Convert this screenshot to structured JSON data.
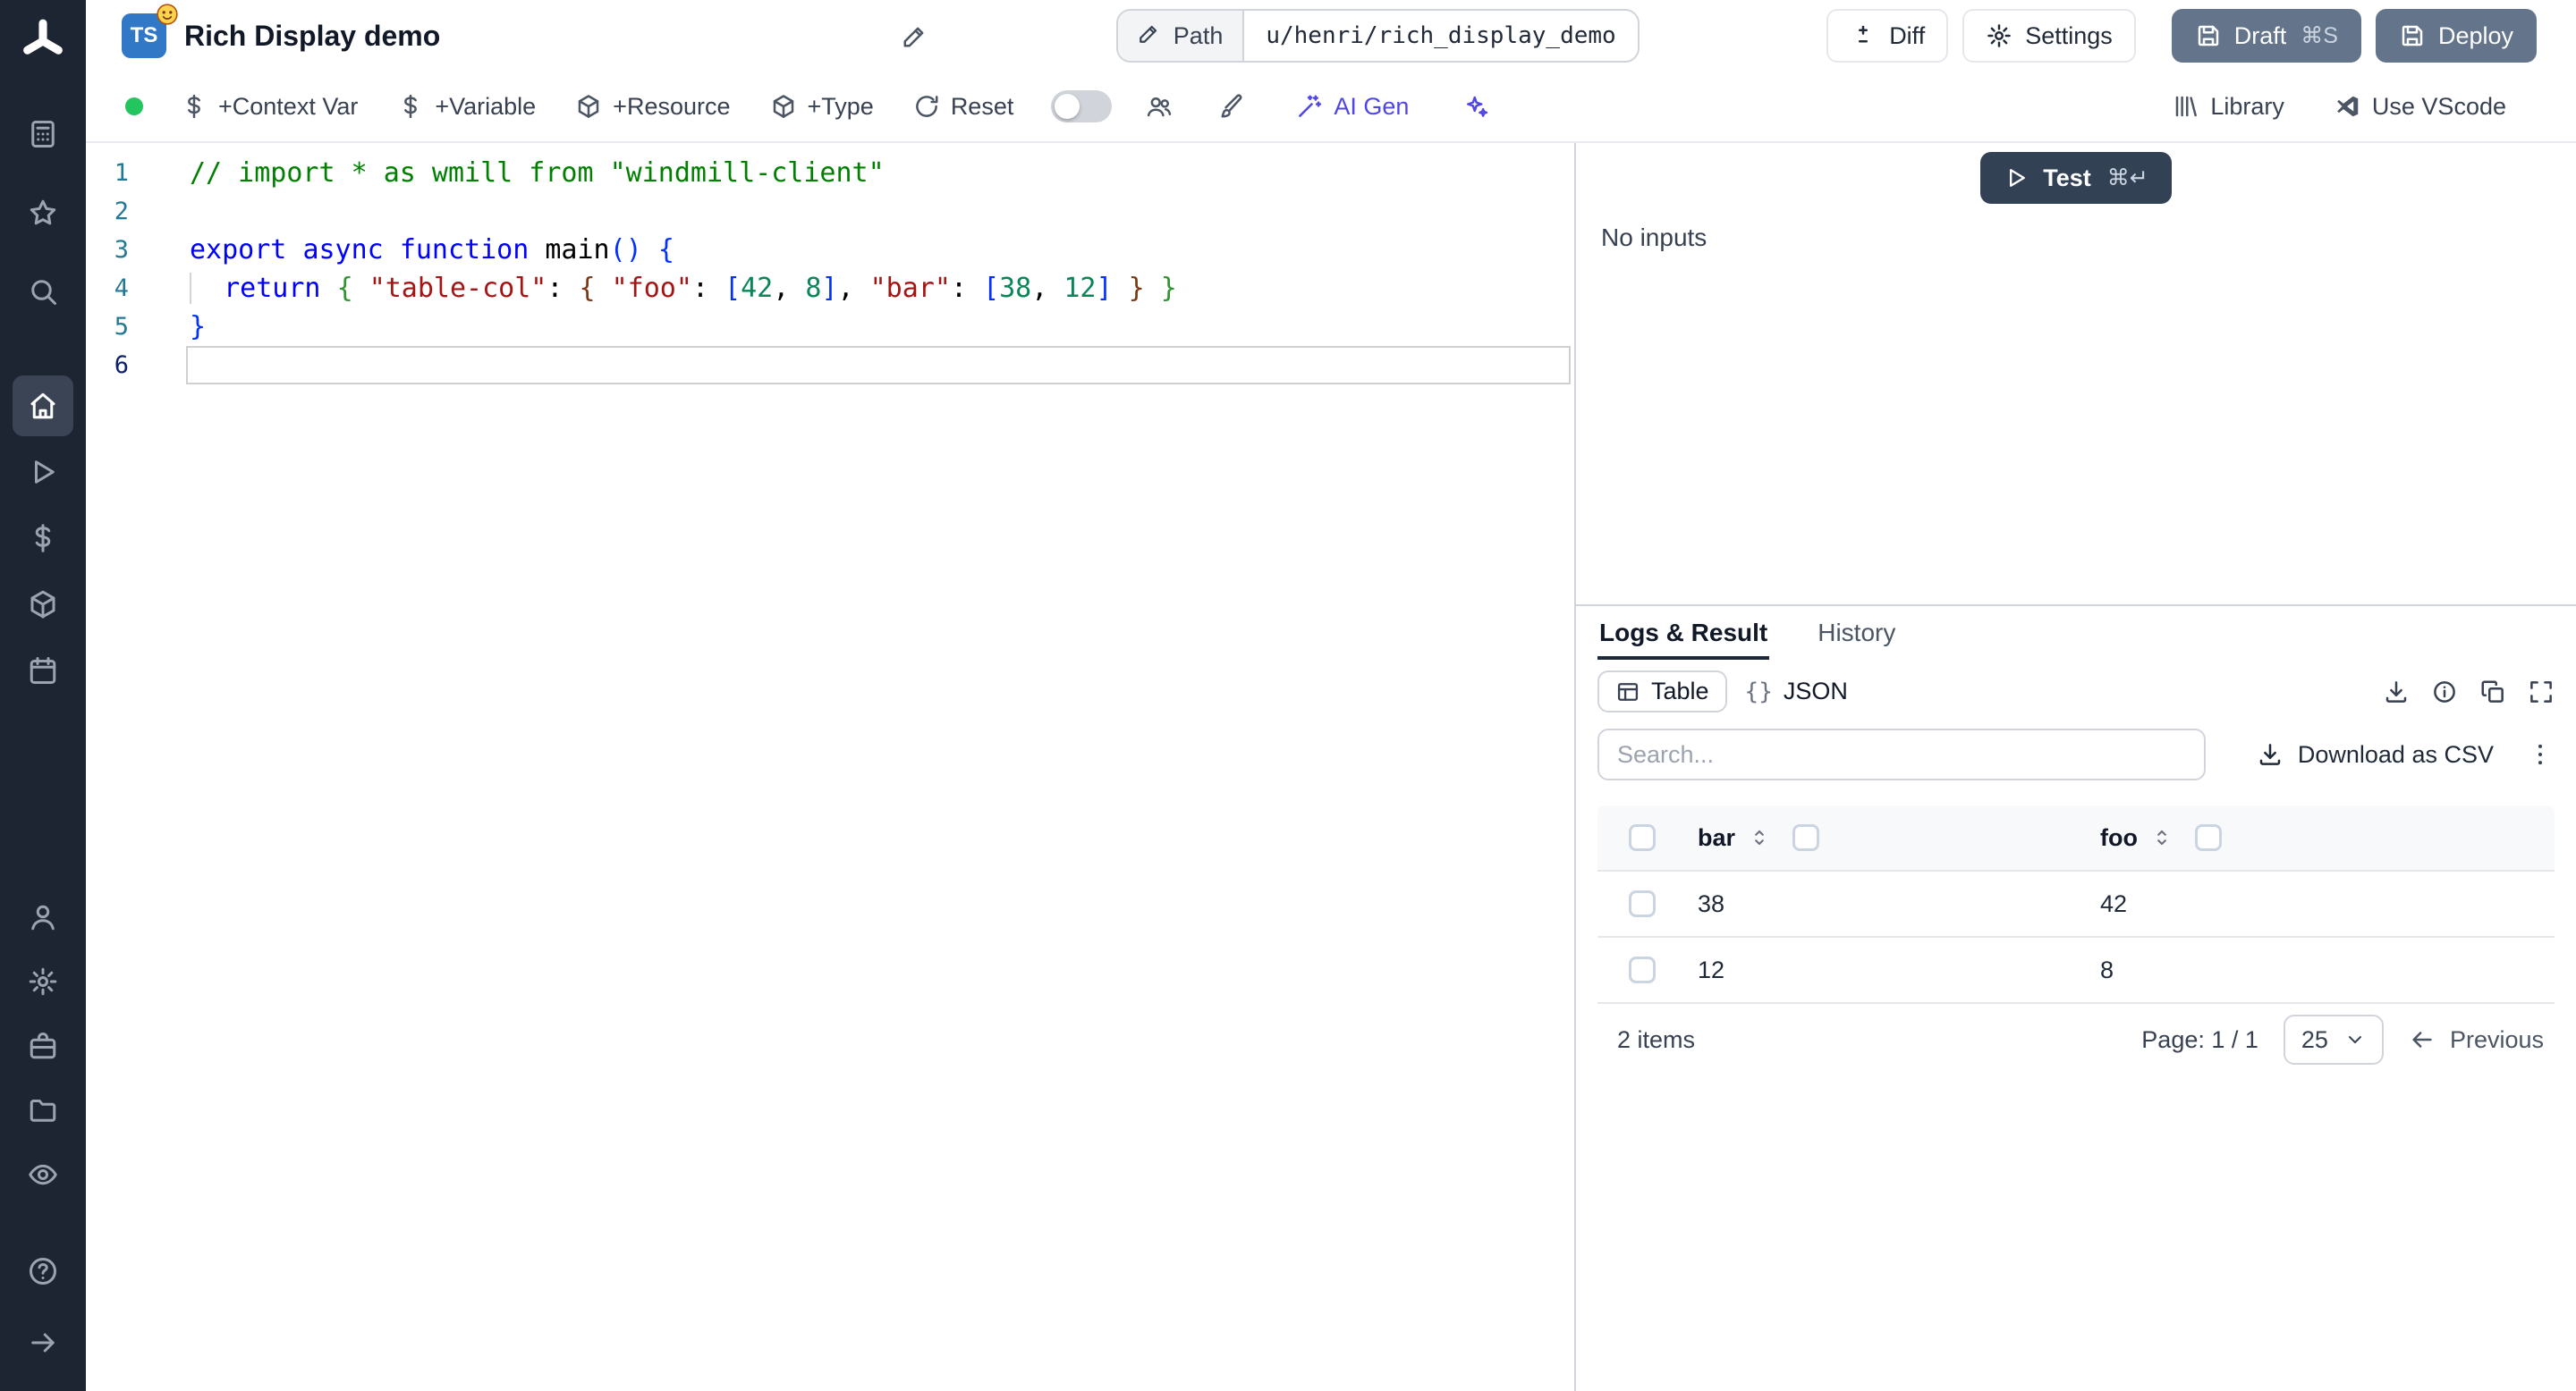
{
  "colors": {
    "ts_badge": "#3178c6",
    "status_dot": "#22c55e",
    "ai_gen": "#4f46e5",
    "slate_button": "#64748b",
    "test_button": "#334155"
  },
  "sidebar": {
    "groups": [
      {
        "items": [
          {
            "icon": "calculator",
            "name": "apps"
          },
          {
            "icon": "star",
            "name": "favorites"
          },
          {
            "icon": "search",
            "name": "search"
          }
        ]
      },
      {
        "items": [
          {
            "icon": "home",
            "name": "home",
            "active": true
          },
          {
            "icon": "play",
            "name": "runs"
          },
          {
            "icon": "dollar",
            "name": "variables"
          },
          {
            "icon": "cube",
            "name": "resources"
          },
          {
            "icon": "calendar",
            "name": "schedules"
          }
        ]
      },
      {
        "items": [
          {
            "icon": "user",
            "name": "users"
          },
          {
            "icon": "gear",
            "name": "settings"
          },
          {
            "icon": "briefcase",
            "name": "workers"
          },
          {
            "icon": "folder",
            "name": "folders"
          },
          {
            "icon": "eye",
            "name": "audit-logs"
          }
        ]
      },
      {
        "items": [
          {
            "icon": "help",
            "name": "help"
          },
          {
            "icon": "arrow-right",
            "name": "expand-sidebar"
          }
        ]
      }
    ]
  },
  "header": {
    "lang_badge": "TS",
    "title": "Rich Display demo",
    "path_label": "Path",
    "path_value": "u/henri/rich_display_demo",
    "diff_label": "Diff",
    "settings_label": "Settings",
    "draft_label": "Draft",
    "draft_shortcut": "⌘S",
    "deploy_label": "Deploy"
  },
  "toolbar": {
    "context_var_label": "+Context Var",
    "variable_label": "+Variable",
    "resource_label": "+Resource",
    "type_label": "+Type",
    "reset_label": "Reset",
    "ai_gen_label": "AI Gen",
    "library_label": "Library",
    "vscode_label": "Use VScode"
  },
  "editor": {
    "lines": [
      {
        "num": "1",
        "tokens": [
          {
            "t": "// import * as wmill from \"windmill-client\"",
            "c": "com"
          }
        ]
      },
      {
        "num": "2",
        "tokens": []
      },
      {
        "num": "3",
        "tokens": [
          {
            "t": "export",
            "c": "kw"
          },
          {
            "t": " ",
            "c": ""
          },
          {
            "t": "async",
            "c": "kw"
          },
          {
            "t": " ",
            "c": ""
          },
          {
            "t": "function",
            "c": "kw"
          },
          {
            "t": " ",
            "c": ""
          },
          {
            "t": "main",
            "c": ""
          },
          {
            "t": "(",
            "c": "b1"
          },
          {
            "t": ")",
            "c": "b1"
          },
          {
            "t": " ",
            "c": ""
          },
          {
            "t": "{",
            "c": "b1"
          }
        ]
      },
      {
        "num": "4",
        "tokens": [
          {
            "t": "  ",
            "c": "guide"
          },
          {
            "t": "return",
            "c": "kw"
          },
          {
            "t": " ",
            "c": ""
          },
          {
            "t": "{",
            "c": "b2"
          },
          {
            "t": " ",
            "c": ""
          },
          {
            "t": "\"table-col\"",
            "c": "str"
          },
          {
            "t": ": ",
            "c": ""
          },
          {
            "t": "{",
            "c": "b3"
          },
          {
            "t": " ",
            "c": ""
          },
          {
            "t": "\"foo\"",
            "c": "str"
          },
          {
            "t": ": ",
            "c": ""
          },
          {
            "t": "[",
            "c": "b1"
          },
          {
            "t": "42",
            "c": "num"
          },
          {
            "t": ", ",
            "c": ""
          },
          {
            "t": "8",
            "c": "num"
          },
          {
            "t": "]",
            "c": "b1"
          },
          {
            "t": ", ",
            "c": ""
          },
          {
            "t": "\"bar\"",
            "c": "str"
          },
          {
            "t": ": ",
            "c": ""
          },
          {
            "t": "[",
            "c": "b1"
          },
          {
            "t": "38",
            "c": "num"
          },
          {
            "t": ", ",
            "c": ""
          },
          {
            "t": "12",
            "c": "num"
          },
          {
            "t": "]",
            "c": "b1"
          },
          {
            "t": " ",
            "c": ""
          },
          {
            "t": "}",
            "c": "b3"
          },
          {
            "t": " ",
            "c": ""
          },
          {
            "t": "}",
            "c": "b2"
          }
        ]
      },
      {
        "num": "5",
        "tokens": [
          {
            "t": "}",
            "c": "b1"
          }
        ]
      },
      {
        "num": "6",
        "tokens": [],
        "current": true
      }
    ]
  },
  "runner": {
    "test_label": "Test",
    "test_shortcut": "⌘↵",
    "no_inputs": "No inputs"
  },
  "result": {
    "tabs": [
      {
        "label": "Logs & Result"
      },
      {
        "label": "History"
      }
    ],
    "views": [
      {
        "icon": "table",
        "label": "Table"
      },
      {
        "icon_text": "{}",
        "label": "JSON"
      }
    ],
    "search_placeholder": "Search...",
    "download_csv_label": "Download as CSV",
    "table": {
      "columns": [
        "bar",
        "foo"
      ],
      "rows": [
        [
          "38",
          "42"
        ],
        [
          "12",
          "8"
        ]
      ],
      "items_label": "2 items",
      "page_label": "Page: 1 / 1",
      "page_size": "25",
      "previous_label": "Previous"
    }
  }
}
